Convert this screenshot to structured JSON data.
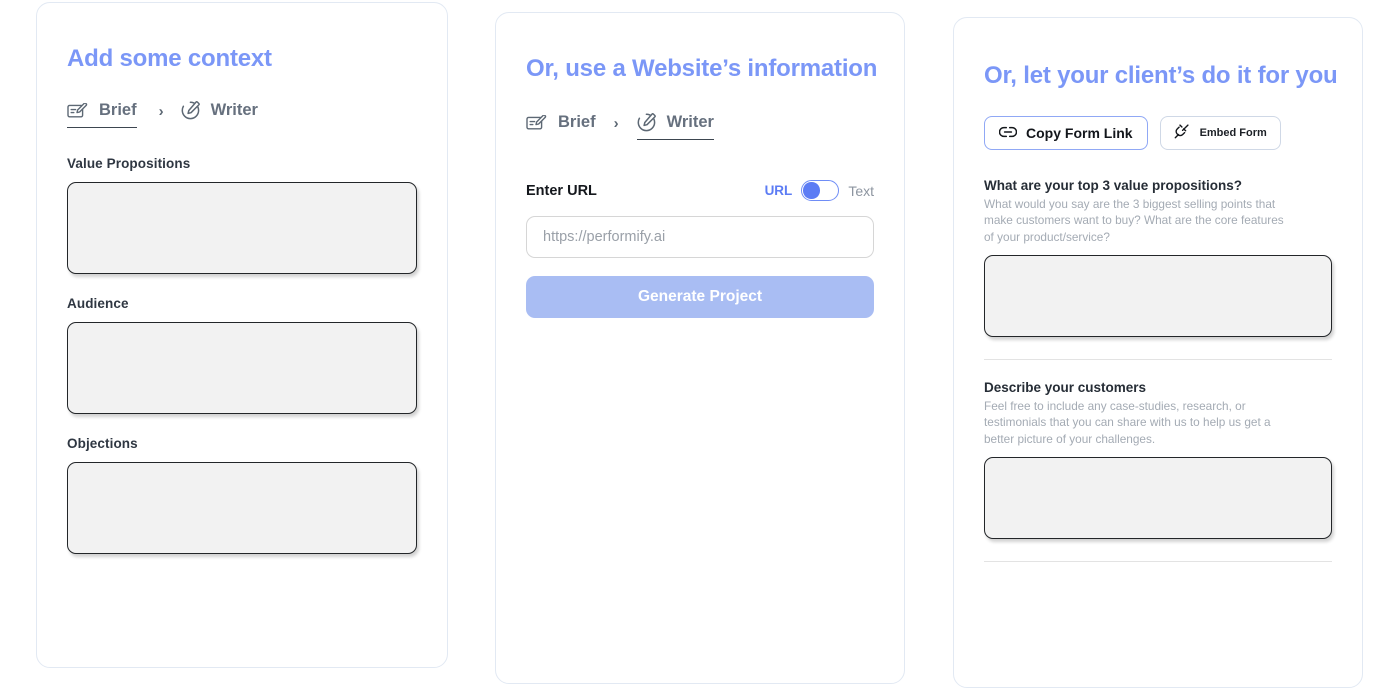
{
  "theme": {
    "heading_blue": "#7b97f7",
    "accent_blue": "#5c7cf4",
    "button_blue": "#a9bdf3",
    "card_border": "#e2e9f3",
    "textarea_fill": "#f2f2f2",
    "textarea_border": "#232629",
    "muted_text": "#a4abb4"
  },
  "panels": {
    "brief": {
      "title": "Add some context",
      "breadcrumb": [
        {
          "label": "Brief",
          "icon": "brief-card-icon",
          "active": true
        },
        {
          "label": "Writer",
          "icon": "writer-pencil-icon",
          "active": false
        }
      ],
      "separator": "›",
      "fields": [
        {
          "label": "Value Propositions",
          "value": "",
          "placeholder": ""
        },
        {
          "label": "Audience",
          "value": "",
          "placeholder": ""
        },
        {
          "label": "Objections",
          "value": "",
          "placeholder": ""
        }
      ]
    },
    "website": {
      "title": "Or, use a Website’s information",
      "breadcrumb": [
        {
          "label": "Brief",
          "icon": "brief-card-icon",
          "active": false
        },
        {
          "label": "Writer",
          "icon": "writer-pencil-icon",
          "active": true
        }
      ],
      "separator": "›",
      "url_label": "Enter URL",
      "toggle": {
        "option_on": "URL",
        "option_off": "Text",
        "selected": "URL"
      },
      "url_input": {
        "value": "",
        "placeholder": "https://performify.ai"
      },
      "generate_button": "Generate Project"
    },
    "client": {
      "title": "Or, let your client’s do it for you",
      "actions": [
        {
          "label": "Copy Form Link",
          "icon": "link-chain-icon",
          "style": "primary"
        },
        {
          "label": "Embed Form",
          "icon": "plug-icon",
          "style": "secondary"
        }
      ],
      "questions": [
        {
          "title": "What are your top 3 value propositions?",
          "description": "What would you say are the 3 biggest selling points that make customers want to buy?  What are the core features of your product/service?",
          "value": "",
          "placeholder": ""
        },
        {
          "title": "Describe your customers",
          "description": "Feel free to include any case-studies, research, or testimonials that you can share with us to help us get a better picture of your challenges.",
          "value": "",
          "placeholder": ""
        }
      ]
    }
  }
}
